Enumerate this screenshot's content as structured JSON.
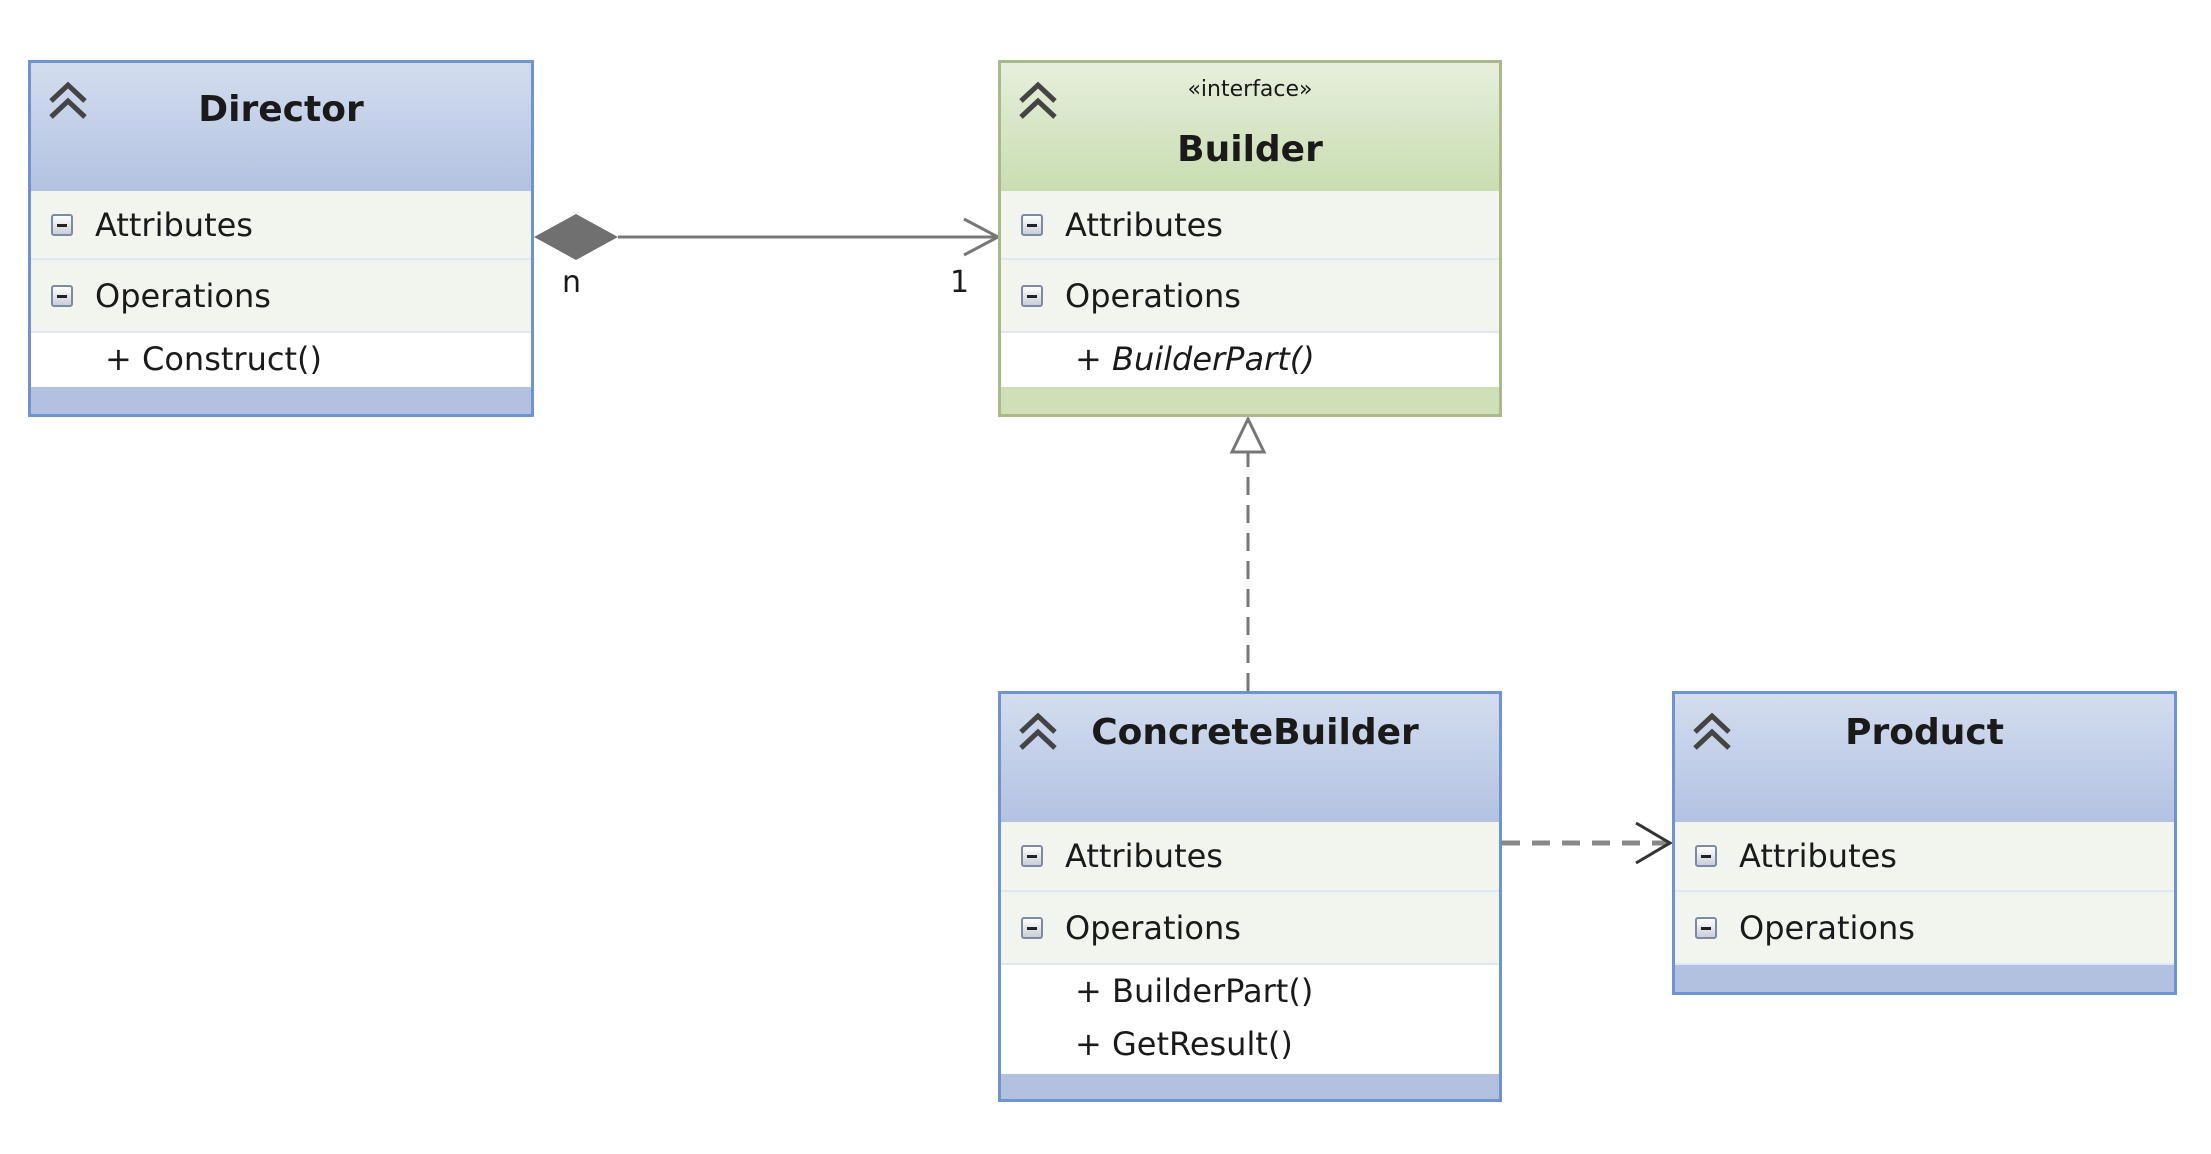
{
  "classes": {
    "director": {
      "name": "Director",
      "attributes_label": "Attributes",
      "operations_label": "Operations",
      "operations": [
        "+ Construct()"
      ]
    },
    "builder": {
      "stereotype": "«interface»",
      "name": "Builder",
      "attributes_label": "Attributes",
      "operations_label": "Operations",
      "operations": [
        "+ BuilderPart()"
      ]
    },
    "concrete_builder": {
      "name": "ConcreteBuilder",
      "attributes_label": "Attributes",
      "operations_label": "Operations",
      "operations": [
        "+ BuilderPart()",
        "+ GetResult()"
      ]
    },
    "product": {
      "name": "Product",
      "attributes_label": "Attributes",
      "operations_label": "Operations"
    }
  },
  "relationships": {
    "director_builder": {
      "type": "composition",
      "source_multiplicity": "n",
      "target_multiplicity": "1"
    },
    "concrete_builder_builder": {
      "type": "realization"
    },
    "concrete_builder_product": {
      "type": "dependency"
    }
  },
  "colors": {
    "class_border": "#6f93cf",
    "class_fill": "#b3c1e0",
    "interface_border": "#a9b98a",
    "interface_fill": "#cfe0b8",
    "connector": "#666666"
  },
  "icons": {
    "collapse": "double-chevron-up-icon",
    "section_toggle": "minus-box-icon"
  }
}
